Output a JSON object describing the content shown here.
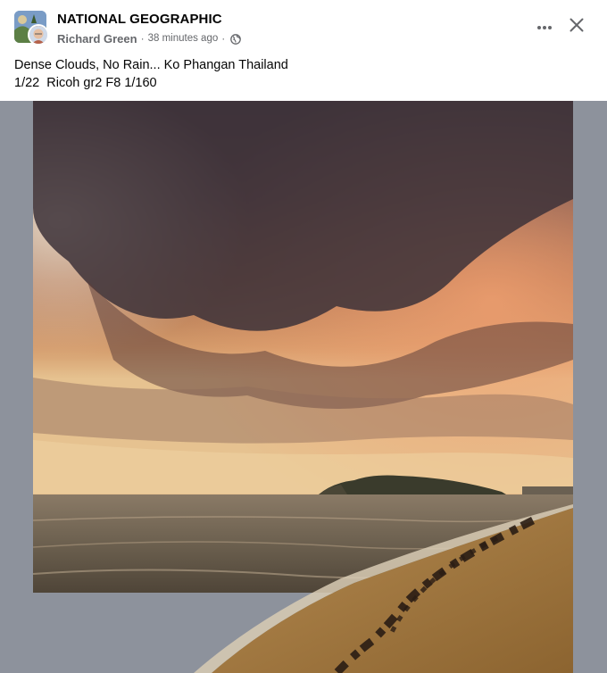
{
  "post": {
    "group_name": "NATIONAL GEOGRAPHIC",
    "author": "Richard Green",
    "separator": "·",
    "timestamp": "38 minutes ago",
    "audience_icon": "globe-icon",
    "caption_lines": [
      "Dense Clouds, No Rain... Ko Phangan Thailand",
      "1/22  Ricoh gr2 F8 1/160"
    ]
  },
  "actions": {
    "more_icon": "more-horizontal-icon",
    "close_icon": "close-icon"
  },
  "photo": {
    "alt": "Dense clouds over beach at Ko Phangan"
  },
  "colors": {
    "text_primary": "#050505",
    "text_secondary": "#65676b",
    "frame_background": "#8d929c"
  }
}
